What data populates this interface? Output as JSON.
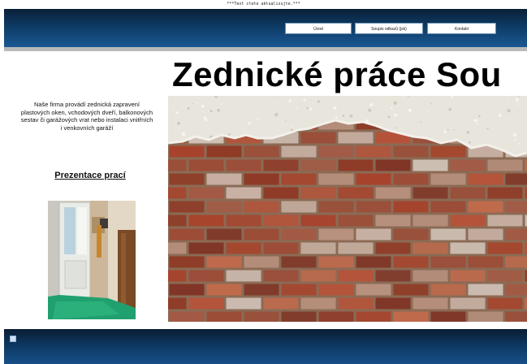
{
  "top_notice": "***Text ctete aktualizujte.***",
  "header": {
    "nav": [
      {
        "label": "Úvod"
      },
      {
        "label": "Soupis odkazů (jsk)"
      },
      {
        "label": "Kontakt"
      }
    ]
  },
  "main": {
    "title": "Zednické práce Sou",
    "intro_text": "Naše firma provádí zednická zapravení plastových oken, vchodových dveří, balkonových sestav či garážových vrat nebo instalaci vnitřních i venkovních garáží",
    "gallery_link": "Prezentace prací"
  },
  "colors": {
    "header_top": "#0a2038",
    "header_bottom": "#1b5894",
    "rule": "#b9b9b9"
  },
  "icons": {
    "footer": "footer-square-icon"
  }
}
